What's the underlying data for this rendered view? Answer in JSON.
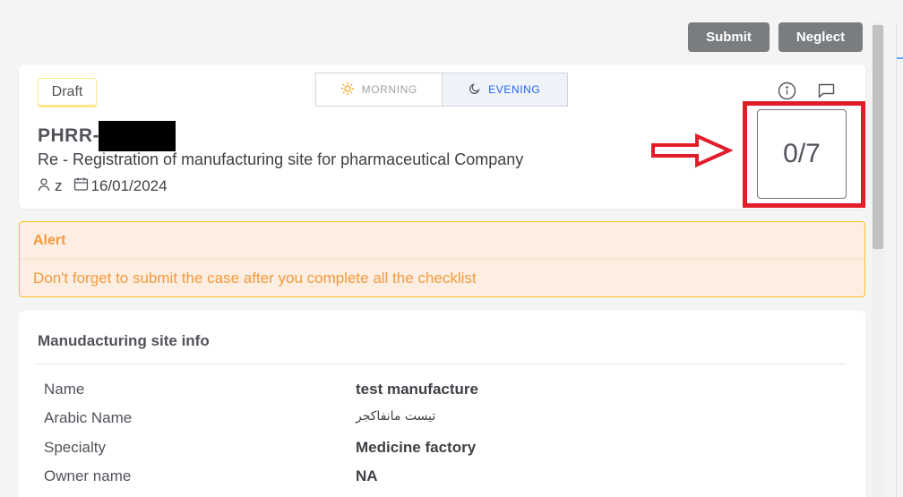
{
  "toolbar": {
    "submit_label": "Submit",
    "neglect_label": "Neglect"
  },
  "case": {
    "status": "Draft",
    "shift": {
      "morning_label": "MORNING",
      "evening_label": "EVENING",
      "selected": "evening"
    },
    "code_prefix": "PHRR-",
    "title": "Re - Registration of manufacturing site for pharmaceutical Company",
    "assignee": "z",
    "date": "16/01/2024",
    "progress": "0/7"
  },
  "alert": {
    "title": "Alert",
    "message": "Don't forget to submit the case after you complete all the checklist"
  },
  "site_info": {
    "title": "Manudacturing site info",
    "rows": [
      {
        "label": "Name",
        "value": "test manufacture"
      },
      {
        "label": "Arabic Name",
        "value": "تيست مانفاكجر"
      },
      {
        "label": "Specialty",
        "value": "Medicine factory"
      },
      {
        "label": "Owner name",
        "value": "NA"
      }
    ]
  },
  "colors": {
    "accent": "#2563eb",
    "alert_text": "#f39a3f",
    "highlight": "#e11d2a",
    "button": "#7a7d80"
  }
}
